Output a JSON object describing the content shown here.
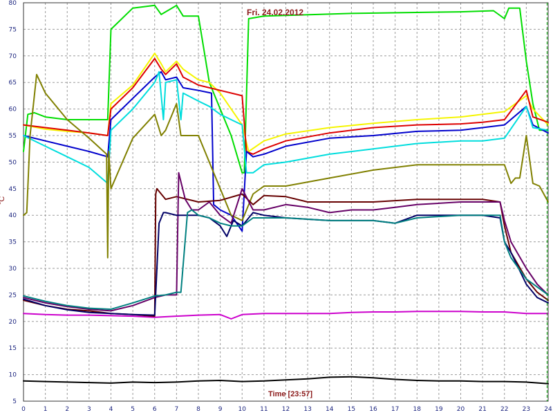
{
  "chart_data": {
    "type": "line",
    "title": "Fri. 24.02.2012",
    "xlabel": "Time [23:57]",
    "ylabel": "°C",
    "xlim": [
      0,
      24
    ],
    "ylim": [
      5,
      80
    ],
    "xticks": [
      "0",
      "1",
      "2",
      "3",
      "4",
      "5",
      "6",
      "7",
      "8",
      "9",
      "10",
      "11",
      "12",
      "13",
      "14",
      "15",
      "16",
      "17",
      "18",
      "19",
      "20",
      "21",
      "22",
      "23",
      "24"
    ],
    "yticks": [
      "80",
      "75",
      "70",
      "65",
      "60",
      "55",
      "50",
      "45",
      "40",
      "35",
      "30",
      "25",
      "20",
      "15",
      "10",
      "5"
    ],
    "grid": true,
    "current_time_x": 23.95,
    "series": [
      {
        "color": "#00dd00",
        "x": [
          0,
          0.2,
          0.5,
          1,
          2,
          3,
          3.85,
          4.0,
          5,
          6,
          6.3,
          7,
          7.3,
          8,
          8.5,
          9,
          9.5,
          10,
          10.1,
          10.3,
          11,
          15,
          20,
          21.5,
          22,
          22.2,
          22.7,
          23,
          23.3,
          23.6,
          24
        ],
        "y": [
          52,
          59,
          59.3,
          58.5,
          58,
          58,
          58,
          75,
          79,
          79.5,
          77.8,
          79.5,
          77.5,
          77.5,
          65,
          60,
          55,
          48,
          48,
          77,
          77.5,
          78,
          78.3,
          78.5,
          77,
          79,
          79,
          69,
          61,
          56,
          56
        ]
      },
      {
        "color": "#f5f500",
        "x": [
          0,
          1,
          2,
          3,
          3.85,
          4,
          5,
          6,
          6.3,
          6.5,
          7,
          7.3,
          8,
          8.5,
          9,
          9.5,
          10,
          10.3,
          11,
          12,
          14,
          16,
          18,
          20,
          21,
          22,
          23,
          23.3,
          24
        ],
        "y": [
          57,
          56.2,
          55.8,
          55.5,
          55,
          61,
          64.5,
          70.5,
          68.5,
          67,
          69,
          67.5,
          65.5,
          65,
          63,
          60,
          57,
          52,
          54,
          55.3,
          56.5,
          57.3,
          58,
          58.5,
          59,
          59.5,
          62.5,
          60,
          57
        ]
      },
      {
        "color": "#dd0000",
        "x": [
          0,
          1,
          2,
          3,
          3.85,
          4,
          5,
          6,
          6.3,
          6.5,
          7,
          7.3,
          8,
          8.5,
          9,
          10,
          10.2,
          10.5,
          11,
          12,
          14,
          16,
          18,
          20,
          21,
          22,
          23,
          23.3,
          24
        ],
        "y": [
          57,
          56.5,
          56,
          55.5,
          55,
          60,
          64,
          69.5,
          67.5,
          66.5,
          68.5,
          66,
          64.5,
          64,
          63.5,
          62.5,
          52,
          51.5,
          52.5,
          54,
          55.5,
          56.5,
          57,
          57.2,
          57.5,
          58,
          63.5,
          58.5,
          57.5
        ]
      },
      {
        "color": "#0000cc",
        "x": [
          0,
          1,
          2,
          3,
          3.85,
          4,
          5,
          6,
          6.3,
          6.5,
          7,
          7.3,
          8,
          8.6,
          8.7,
          9,
          9.5,
          10,
          10.2,
          10.5,
          11,
          12,
          14,
          16,
          18,
          20,
          21,
          22,
          23,
          23.3,
          24
        ],
        "y": [
          55,
          54,
          53,
          52,
          51,
          58,
          62,
          66,
          67,
          65.5,
          66,
          64,
          63.5,
          63,
          42,
          41,
          40,
          37,
          52,
          51,
          51.5,
          53,
          54.5,
          55,
          55.8,
          56,
          56.5,
          57,
          60.5,
          57,
          55.5
        ]
      },
      {
        "color": "#00dddd",
        "x": [
          0,
          1,
          2,
          3,
          3.85,
          4,
          5,
          6,
          6.2,
          6.4,
          6.5,
          7,
          7.2,
          7.3,
          8,
          8.5,
          9,
          9.5,
          10,
          10.2,
          10.5,
          11,
          12,
          14,
          16,
          17,
          18,
          20,
          21,
          22,
          23,
          23.3,
          24
        ],
        "y": [
          55,
          53,
          51,
          49,
          46,
          56,
          60,
          65,
          67,
          58,
          65,
          65.5,
          58,
          63,
          61.5,
          60.5,
          59,
          58,
          57,
          48,
          48,
          49.5,
          50,
          51.5,
          52.5,
          53,
          53.5,
          54,
          54,
          54.5,
          60.5,
          56.5,
          56
        ]
      },
      {
        "color": "#808000",
        "x": [
          0,
          0.15,
          0.3,
          0.6,
          1,
          2,
          3,
          3.8,
          3.85,
          3.9,
          4,
          5,
          6,
          6.3,
          6.5,
          7,
          7.2,
          7.4,
          8,
          8.5,
          9,
          9.5,
          10,
          10.5,
          11,
          12,
          14,
          16,
          18,
          20,
          21,
          22,
          22.3,
          22.5,
          22.7,
          23,
          23.3,
          23.6,
          24
        ],
        "y": [
          40,
          40.5,
          55,
          66.5,
          63,
          58,
          54.5,
          51.5,
          32,
          52,
          45,
          54.5,
          59,
          55,
          56,
          61,
          55,
          55,
          55,
          50,
          45,
          40,
          39,
          44,
          45.5,
          45.5,
          47,
          48.5,
          49.5,
          49.5,
          49.5,
          49.5,
          46,
          47,
          47,
          55,
          46,
          45.5,
          42.5
        ]
      },
      {
        "color": "#cc00cc",
        "x": [
          0,
          1,
          2,
          3,
          4,
          5,
          6,
          7,
          8,
          9,
          9.5,
          10,
          11,
          14,
          15,
          16,
          17,
          18,
          20,
          21,
          22,
          23,
          24
        ],
        "y": [
          21.5,
          21.3,
          21.2,
          21.2,
          21.1,
          21,
          20.8,
          21,
          21.2,
          21.3,
          20.5,
          21.3,
          21.5,
          21.5,
          21.7,
          21.8,
          21.8,
          21.9,
          21.9,
          21.8,
          21.8,
          21.5,
          21.5
        ]
      },
      {
        "color": "#660000",
        "x": [
          0,
          1,
          2,
          3,
          4,
          5,
          6,
          6.05,
          6.1,
          6.5,
          7,
          8,
          9,
          10,
          10.5,
          11,
          12,
          13,
          14,
          15,
          16,
          18,
          20,
          21,
          21.8,
          22,
          22.3,
          23,
          23.5,
          24
        ],
        "y": [
          24,
          23,
          22.3,
          22,
          21.5,
          21.3,
          21,
          44,
          45,
          43,
          43.5,
          42.5,
          42.8,
          44,
          42,
          43.7,
          43.5,
          42.5,
          42.5,
          42.5,
          42.5,
          43,
          43,
          43,
          42.5,
          38,
          33,
          28,
          25.5,
          24
        ]
      },
      {
        "color": "#660066",
        "x": [
          0,
          1,
          2,
          3,
          4,
          5,
          6,
          6.5,
          7.0,
          7.1,
          7.4,
          7.7,
          8,
          8.5,
          9,
          9.5,
          10,
          10.5,
          11,
          12,
          13,
          14,
          15,
          16,
          17,
          18,
          20,
          21,
          21.8,
          22,
          22.3,
          23,
          23.5,
          24
        ],
        "y": [
          24.5,
          23.5,
          22.8,
          22.3,
          22,
          23,
          24.5,
          25,
          25,
          48,
          43,
          41,
          41,
          42.5,
          40,
          38.5,
          45,
          41,
          41,
          42,
          41.5,
          40.5,
          41,
          41,
          41.5,
          42,
          42.5,
          42.5,
          42.5,
          39,
          35,
          30,
          27,
          25
        ]
      },
      {
        "color": "#000066",
        "x": [
          0,
          1,
          2,
          3,
          4,
          5,
          6,
          6.2,
          6.4,
          6.5,
          7,
          8,
          8.5,
          9,
          9.3,
          9.6,
          10,
          10.5,
          11,
          12,
          14,
          16,
          17,
          18,
          20,
          21,
          21.8,
          22,
          22.3,
          23,
          23.5,
          24
        ],
        "y": [
          24.2,
          23,
          22.2,
          21.7,
          21.5,
          21.3,
          21.2,
          38.5,
          40.5,
          40.5,
          40,
          40,
          39.5,
          38,
          36,
          39,
          38,
          40.5,
          40,
          39.5,
          39,
          39,
          38.5,
          40,
          40,
          40,
          39.5,
          35,
          33,
          27,
          24.5,
          23.5
        ]
      },
      {
        "color": "#008080",
        "x": [
          0,
          1,
          2,
          3,
          4,
          5,
          6,
          6.5,
          7,
          7.2,
          7.5,
          7.7,
          8,
          8.5,
          9,
          9.5,
          10,
          10.5,
          11,
          12,
          14,
          16,
          17,
          18,
          20,
          21,
          21.8,
          22,
          22.3,
          23,
          23.5,
          24
        ],
        "y": [
          24.8,
          23.8,
          23,
          22.5,
          22.3,
          23.5,
          24.8,
          25,
          25.5,
          25.5,
          40.5,
          41,
          40,
          39.5,
          38.5,
          38,
          38,
          39.5,
          39.5,
          39.5,
          39,
          39,
          38.5,
          39.5,
          40,
          40,
          40,
          35,
          32,
          28,
          26.5,
          25
        ]
      },
      {
        "color": "#000000",
        "x": [
          0,
          1,
          2,
          3,
          4,
          5,
          6,
          7,
          8,
          9,
          10,
          11,
          12,
          13,
          14,
          15,
          16,
          17,
          18,
          19,
          20,
          21,
          22,
          23,
          24
        ],
        "y": [
          8.8,
          8.7,
          8.6,
          8.5,
          8.4,
          8.6,
          8.5,
          8.6,
          8.8,
          8.9,
          8.7,
          8.8,
          9,
          9.2,
          9.5,
          9.6,
          9.4,
          9.1,
          8.9,
          8.8,
          8.8,
          8.7,
          8.7,
          8.6,
          8.3
        ]
      }
    ]
  }
}
